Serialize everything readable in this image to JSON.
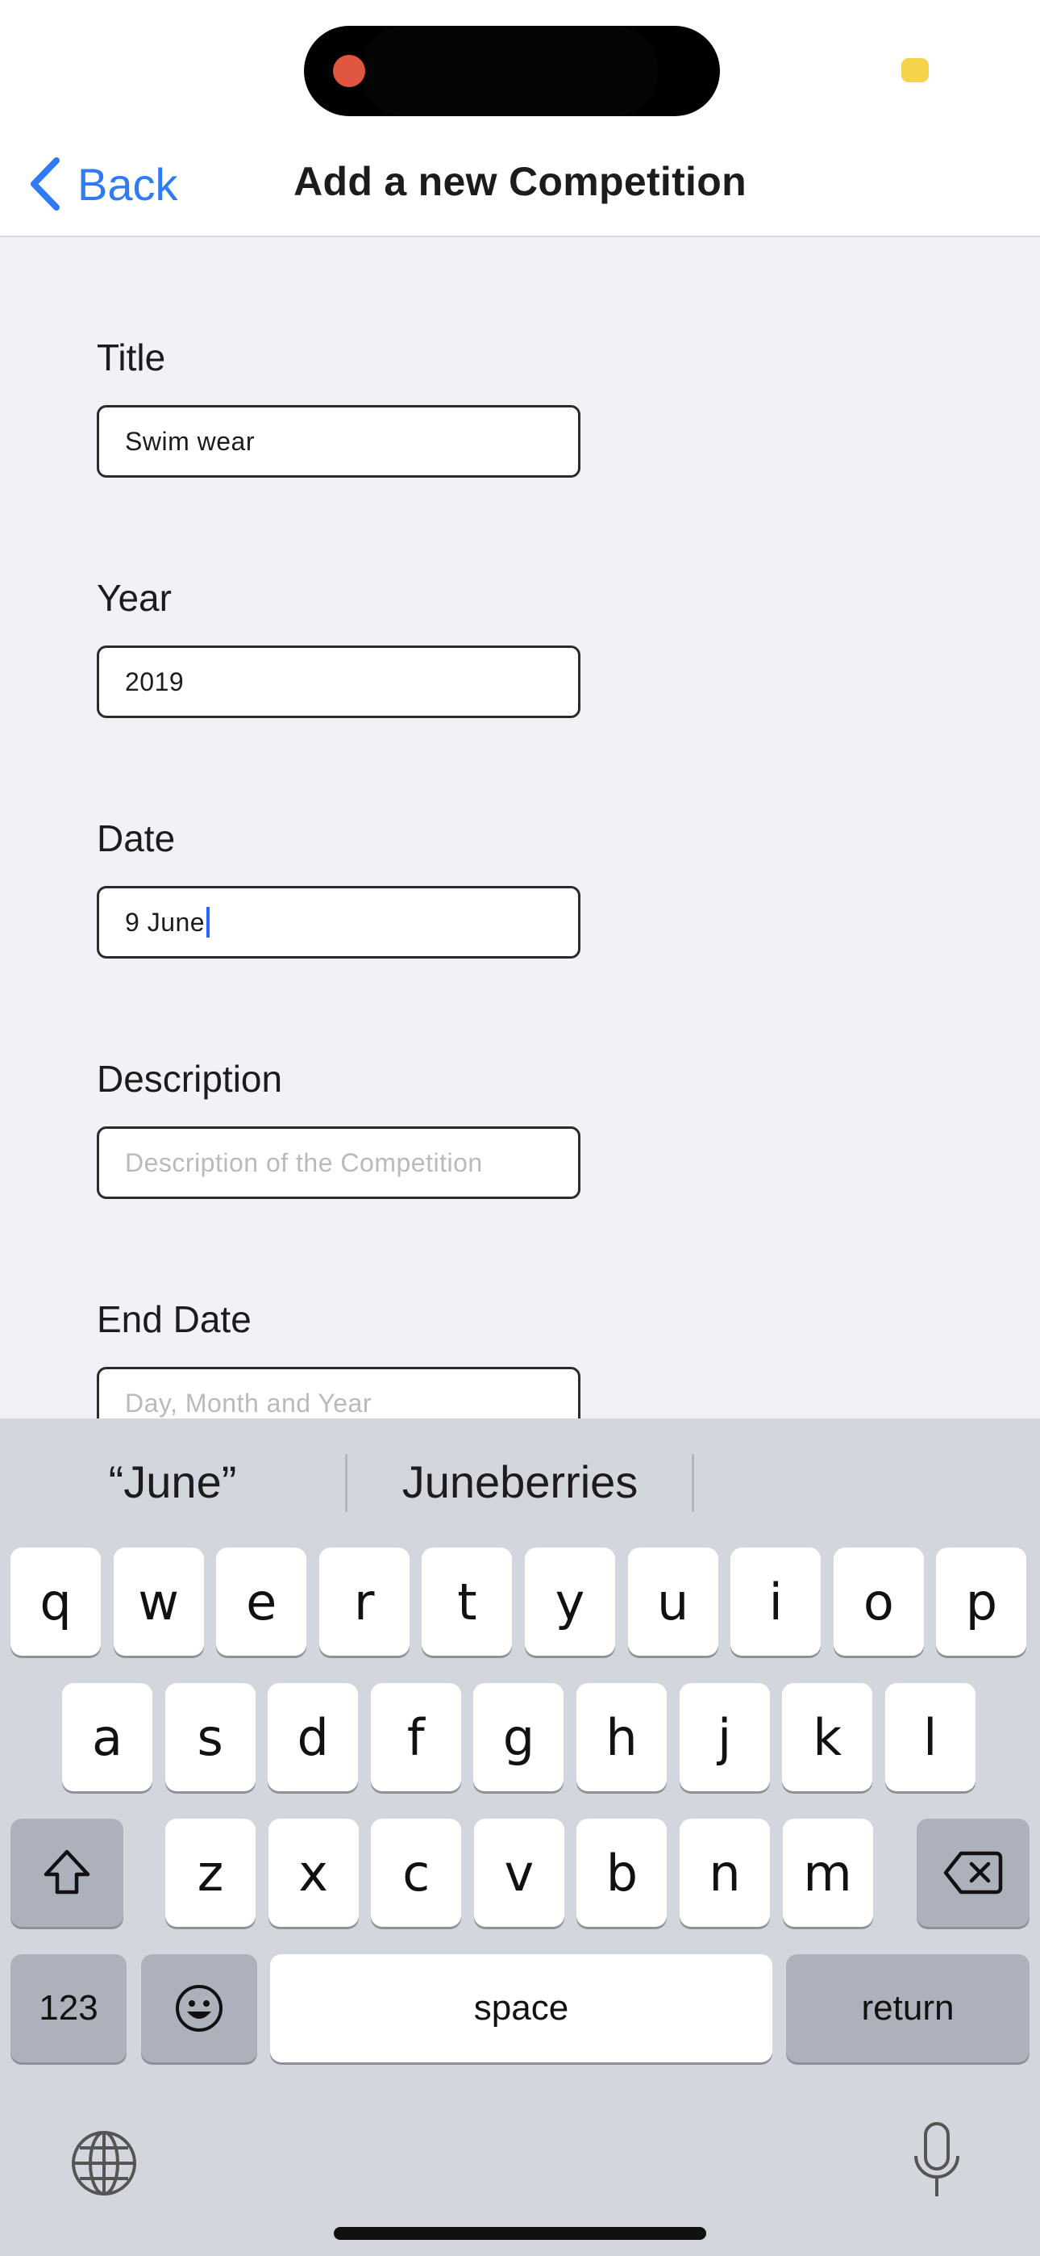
{
  "nav": {
    "back_label": "Back",
    "title": "Add a new Competition"
  },
  "form": {
    "fields": [
      {
        "label": "Title",
        "value": "Swim wear",
        "placeholder": ""
      },
      {
        "label": "Year",
        "value": "2019",
        "placeholder": ""
      },
      {
        "label": "Date",
        "value": "9 June",
        "placeholder": ""
      },
      {
        "label": "Description",
        "value": "",
        "placeholder": "Description of the Competition"
      },
      {
        "label": "End Date",
        "value": "",
        "placeholder": "Day, Month and Year"
      }
    ]
  },
  "keyboard": {
    "suggestions": [
      "“June”",
      "Juneberries"
    ],
    "row1": [
      "q",
      "w",
      "e",
      "r",
      "t",
      "y",
      "u",
      "i",
      "o",
      "p"
    ],
    "row2": [
      "a",
      "s",
      "d",
      "f",
      "g",
      "h",
      "j",
      "k",
      "l"
    ],
    "row3": [
      "z",
      "x",
      "c",
      "v",
      "b",
      "n",
      "m"
    ],
    "numbers_label": "123",
    "space_label": "space",
    "return_label": "return"
  },
  "colors": {
    "accent": "#2f7bf5",
    "form_bg": "#f2f2f6",
    "keyboard_bg": "#d4d6dd"
  }
}
